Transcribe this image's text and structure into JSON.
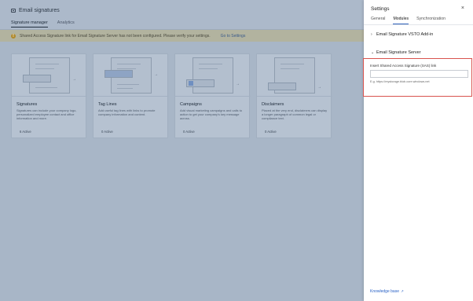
{
  "app": {
    "title": "Email signatures",
    "tabs": [
      "Signature manager",
      "Analytics"
    ]
  },
  "warning": {
    "icon": "!",
    "text": "Shared Access Signature link for Email Signature Server has not been configured. Please verify your settings.",
    "link": "Go to Settings"
  },
  "cards": [
    {
      "name": "Signatures",
      "desc": "Signatures can include your company logo, personalized employee contact and office information and more.",
      "status": "6 Active"
    },
    {
      "name": "Tag Lines",
      "desc": "Add useful tag lines with links to promote company information and content.",
      "status": "0 Active"
    },
    {
      "name": "Campaigns",
      "desc": "Add visual marketing campaigns and calls to action to get your company's key message across.",
      "status": "0 Active"
    },
    {
      "name": "Disclaimers",
      "desc": "Placed at the very end, disclaimers can display a longer paragraph of common legal or compliance text.",
      "status": "0 Active"
    }
  ],
  "settings": {
    "title": "Settings",
    "close": "×",
    "tabs": [
      "General",
      "Modules",
      "Synchronization"
    ],
    "section_vsto": "Email Signature VSTO Add-in",
    "section_server": "Email Signature Server",
    "sas_label": "Insert Shared Access Signature (SAS) link",
    "sas_value": "",
    "sas_hint": "E.g. https://mystorage.blob.core.windows.net",
    "kb_link": "Knowledge base",
    "chevron_collapsed": "›",
    "chevron_expanded": "⌄"
  },
  "colors": {
    "accent": "#2b63c6",
    "highlight": "#d9534f",
    "warning": "#b08a2c"
  }
}
